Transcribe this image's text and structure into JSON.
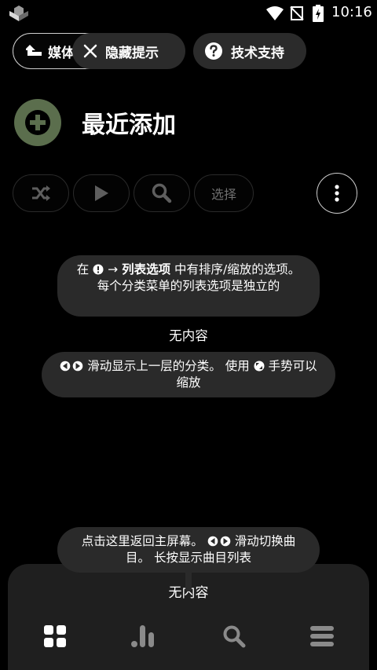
{
  "status_bar": {
    "time": "10:16"
  },
  "top_chips": {
    "media": "媒体",
    "hide_tips": "隐藏提示",
    "support": "技术支持"
  },
  "header": {
    "title": "最近添加"
  },
  "actions": {
    "select": "选择"
  },
  "tips": {
    "tip1_prefix": "在",
    "tip1_bold": "列表选项",
    "tip1_suffix": "中有排序/缩放的选项。每个分类菜单的列表选项是独立的",
    "tip2_part1": "滑动显示上一层的分类。 使用",
    "tip2_part2": "手势可以缩放",
    "tip3_part1": "点击这里返回主屏幕。",
    "tip3_part2": "滑动切换曲目。 长按显示曲目列表"
  },
  "content": {
    "empty_label": "无内容"
  },
  "player": {
    "empty_label": "无内容"
  },
  "icons": {
    "logo": "app-logo-icon",
    "wifi": "wifi-icon",
    "no_sim": "no-sim-icon",
    "battery": "battery-charging-icon",
    "media_up": "arrow-up-turn-icon",
    "close": "close-icon",
    "help": "help-circle-icon",
    "add": "plus-icon",
    "shuffle": "shuffle-icon",
    "play": "play-icon",
    "search": "search-icon",
    "more": "more-vertical-icon",
    "grid": "grid-icon",
    "stats": "bar-chart-icon",
    "menu": "menu-icon"
  },
  "colors": {
    "accent": "#5b6e4d",
    "tip_bg": "#2a2a2a",
    "panel_bg": "#1f1f1f"
  }
}
